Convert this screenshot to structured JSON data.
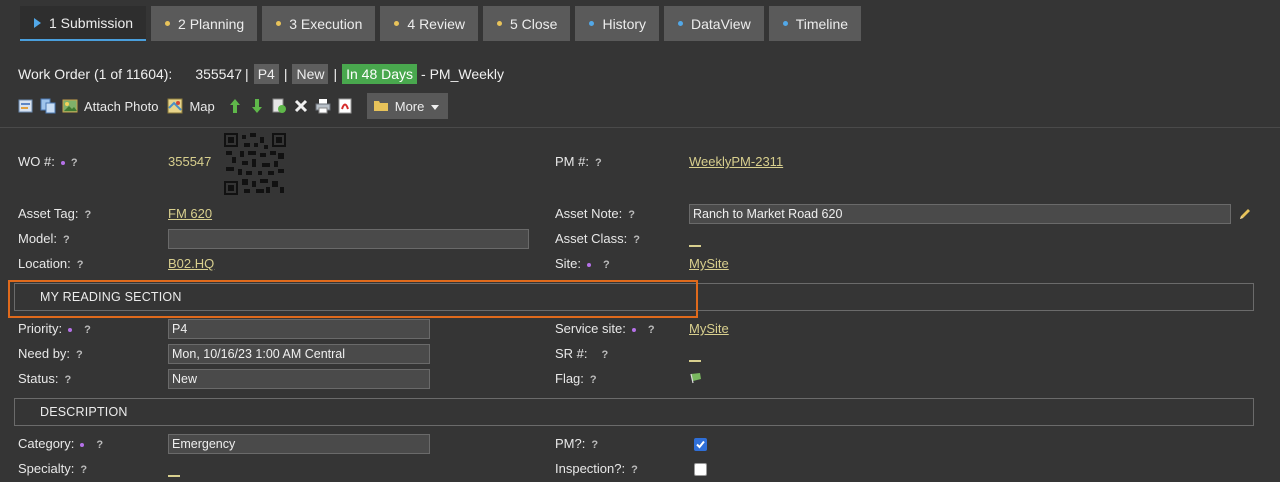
{
  "tabs": [
    {
      "label": "1 Submission",
      "marker": "triangle",
      "color": "#52a8e8",
      "active": true
    },
    {
      "label": "2 Planning",
      "marker": "dot",
      "color": "#e8c35a"
    },
    {
      "label": "3 Execution",
      "marker": "dot",
      "color": "#e8c35a"
    },
    {
      "label": "4 Review",
      "marker": "dot",
      "color": "#e8c35a"
    },
    {
      "label": "5 Close",
      "marker": "dot",
      "color": "#e8c35a"
    },
    {
      "label": "History",
      "marker": "dot",
      "color": "#52a8e8"
    },
    {
      "label": "DataView",
      "marker": "dot",
      "color": "#52a8e8"
    },
    {
      "label": "Timeline",
      "marker": "dot",
      "color": "#52a8e8"
    }
  ],
  "header": {
    "title": "Work Order (1 of 11604):",
    "wo_number": "355547",
    "sep": "|",
    "priority": "P4",
    "status": "New",
    "due": "In 48 Days",
    "pm_name": "- PM_Weekly"
  },
  "toolbar": {
    "attach_photo": "Attach Photo",
    "map": "Map",
    "more": "More"
  },
  "fields": {
    "wo_label": "WO #:",
    "wo_value": "355547",
    "pm_label": "PM #:",
    "pm_value": "WeeklyPM-2311",
    "asset_tag_label": "Asset Tag:",
    "asset_tag_value": "FM 620",
    "asset_note_label": "Asset Note:",
    "asset_note_value": "Ranch to Market Road 620",
    "model_label": "Model:",
    "model_value": "",
    "asset_class_label": "Asset Class:",
    "location_label": "Location:",
    "location_value": "B02.HQ",
    "site_label": "Site:",
    "site_value": "MySite",
    "priority_label": "Priority:",
    "priority_value": "P4",
    "service_site_label": "Service site:",
    "service_site_value": "MySite",
    "need_by_label": "Need by:",
    "need_by_value": "Mon, 10/16/23 1:00 AM Central",
    "sr_label": "SR #:",
    "status_label": "Status:",
    "status_value": "New",
    "flag_label": "Flag:",
    "category_label": "Category:",
    "category_value": "Emergency",
    "pm_flag_label": "PM?:",
    "pm_flag_checked": true,
    "specialty_label": "Specialty:",
    "inspection_label": "Inspection?:",
    "inspection_checked": false
  },
  "sections": {
    "reading": "MY READING SECTION",
    "description": "DESCRIPTION"
  },
  "help_mark": "?",
  "colors": {
    "background": "#353535",
    "tab": "#5a5a5a",
    "link": "#d8cf8e",
    "required_dot": "#b571e8",
    "highlight": "#e06a1c",
    "due_badge": "#49a84e"
  }
}
